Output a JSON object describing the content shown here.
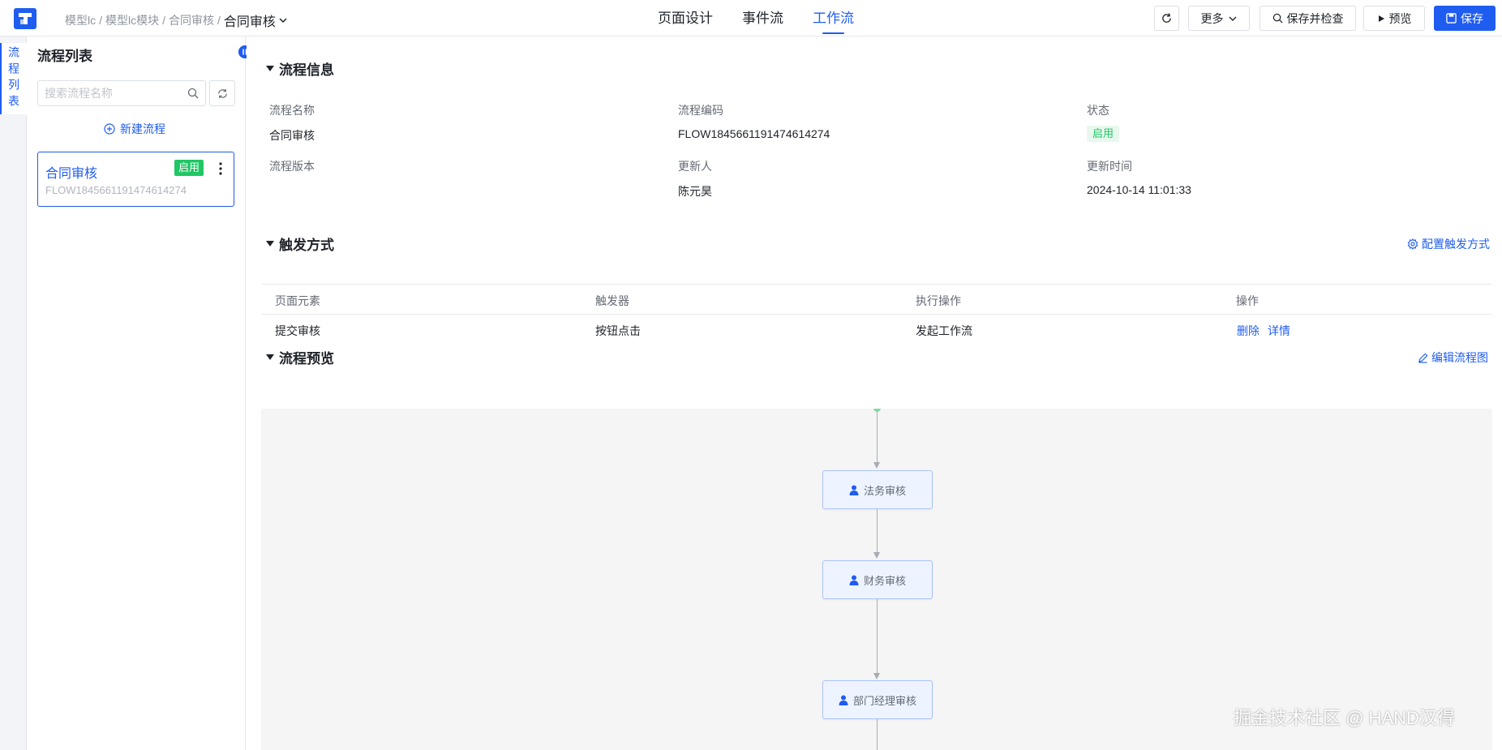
{
  "header": {
    "breadcrumb": [
      "模型lc",
      "模型lc模块",
      "合同审核"
    ],
    "current": "合同审核",
    "tabs": [
      {
        "label": "页面设计",
        "active": false
      },
      {
        "label": "事件流",
        "active": false
      },
      {
        "label": "工作流",
        "active": true
      }
    ],
    "buttons": {
      "more": "更多",
      "save_check": "保存并检查",
      "preview": "预览",
      "save": "保存"
    }
  },
  "rail": {
    "tab_label": "流程列表"
  },
  "flow_list": {
    "title": "流程列表",
    "search_placeholder": "搜索流程名称",
    "new_flow": "新建流程",
    "items": [
      {
        "name": "合同审核",
        "code": "FLOW1845661191474614274",
        "status": "启用"
      }
    ]
  },
  "flow_info": {
    "title": "流程信息",
    "fields": {
      "name": {
        "label": "流程名称",
        "value": "合同审核"
      },
      "code": {
        "label": "流程编码",
        "value": "FLOW1845661191474614274"
      },
      "status": {
        "label": "状态",
        "value": "启用"
      },
      "version": {
        "label": "流程版本",
        "value": ""
      },
      "updater": {
        "label": "更新人",
        "value": "陈元昊"
      },
      "updated_at": {
        "label": "更新时间",
        "value": "2024-10-14 11:01:33"
      }
    }
  },
  "trigger": {
    "title": "触发方式",
    "config_link": "配置触发方式",
    "columns": [
      "页面元素",
      "触发器",
      "执行操作",
      "操作"
    ],
    "rows": [
      {
        "element": "提交审核",
        "trigger": "按钮点击",
        "action": "发起工作流",
        "ops": [
          "删除",
          "详情"
        ]
      }
    ]
  },
  "preview": {
    "title": "流程预览",
    "edit_link": "编辑流程图",
    "nodes": [
      "法务审核",
      "财务审核",
      "部门经理审核"
    ]
  },
  "watermark": "掘金技术社区 @ HAND汉得",
  "colors": {
    "primary": "#1f5cf0",
    "success": "#20c764",
    "canvas_bg": "#f5f5f5"
  }
}
